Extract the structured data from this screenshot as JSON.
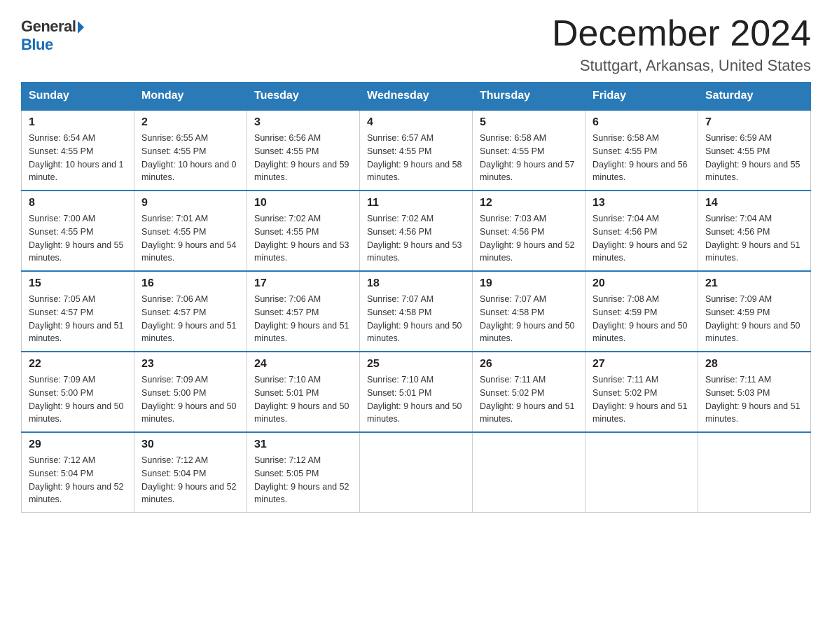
{
  "header": {
    "logo_general": "General",
    "logo_blue": "Blue",
    "month_year": "December 2024",
    "location": "Stuttgart, Arkansas, United States"
  },
  "days_of_week": [
    "Sunday",
    "Monday",
    "Tuesday",
    "Wednesday",
    "Thursday",
    "Friday",
    "Saturday"
  ],
  "weeks": [
    [
      {
        "day": "1",
        "sunrise": "6:54 AM",
        "sunset": "4:55 PM",
        "daylight": "10 hours and 1 minute."
      },
      {
        "day": "2",
        "sunrise": "6:55 AM",
        "sunset": "4:55 PM",
        "daylight": "10 hours and 0 minutes."
      },
      {
        "day": "3",
        "sunrise": "6:56 AM",
        "sunset": "4:55 PM",
        "daylight": "9 hours and 59 minutes."
      },
      {
        "day": "4",
        "sunrise": "6:57 AM",
        "sunset": "4:55 PM",
        "daylight": "9 hours and 58 minutes."
      },
      {
        "day": "5",
        "sunrise": "6:58 AM",
        "sunset": "4:55 PM",
        "daylight": "9 hours and 57 minutes."
      },
      {
        "day": "6",
        "sunrise": "6:58 AM",
        "sunset": "4:55 PM",
        "daylight": "9 hours and 56 minutes."
      },
      {
        "day": "7",
        "sunrise": "6:59 AM",
        "sunset": "4:55 PM",
        "daylight": "9 hours and 55 minutes."
      }
    ],
    [
      {
        "day": "8",
        "sunrise": "7:00 AM",
        "sunset": "4:55 PM",
        "daylight": "9 hours and 55 minutes."
      },
      {
        "day": "9",
        "sunrise": "7:01 AM",
        "sunset": "4:55 PM",
        "daylight": "9 hours and 54 minutes."
      },
      {
        "day": "10",
        "sunrise": "7:02 AM",
        "sunset": "4:55 PM",
        "daylight": "9 hours and 53 minutes."
      },
      {
        "day": "11",
        "sunrise": "7:02 AM",
        "sunset": "4:56 PM",
        "daylight": "9 hours and 53 minutes."
      },
      {
        "day": "12",
        "sunrise": "7:03 AM",
        "sunset": "4:56 PM",
        "daylight": "9 hours and 52 minutes."
      },
      {
        "day": "13",
        "sunrise": "7:04 AM",
        "sunset": "4:56 PM",
        "daylight": "9 hours and 52 minutes."
      },
      {
        "day": "14",
        "sunrise": "7:04 AM",
        "sunset": "4:56 PM",
        "daylight": "9 hours and 51 minutes."
      }
    ],
    [
      {
        "day": "15",
        "sunrise": "7:05 AM",
        "sunset": "4:57 PM",
        "daylight": "9 hours and 51 minutes."
      },
      {
        "day": "16",
        "sunrise": "7:06 AM",
        "sunset": "4:57 PM",
        "daylight": "9 hours and 51 minutes."
      },
      {
        "day": "17",
        "sunrise": "7:06 AM",
        "sunset": "4:57 PM",
        "daylight": "9 hours and 51 minutes."
      },
      {
        "day": "18",
        "sunrise": "7:07 AM",
        "sunset": "4:58 PM",
        "daylight": "9 hours and 50 minutes."
      },
      {
        "day": "19",
        "sunrise": "7:07 AM",
        "sunset": "4:58 PM",
        "daylight": "9 hours and 50 minutes."
      },
      {
        "day": "20",
        "sunrise": "7:08 AM",
        "sunset": "4:59 PM",
        "daylight": "9 hours and 50 minutes."
      },
      {
        "day": "21",
        "sunrise": "7:09 AM",
        "sunset": "4:59 PM",
        "daylight": "9 hours and 50 minutes."
      }
    ],
    [
      {
        "day": "22",
        "sunrise": "7:09 AM",
        "sunset": "5:00 PM",
        "daylight": "9 hours and 50 minutes."
      },
      {
        "day": "23",
        "sunrise": "7:09 AM",
        "sunset": "5:00 PM",
        "daylight": "9 hours and 50 minutes."
      },
      {
        "day": "24",
        "sunrise": "7:10 AM",
        "sunset": "5:01 PM",
        "daylight": "9 hours and 50 minutes."
      },
      {
        "day": "25",
        "sunrise": "7:10 AM",
        "sunset": "5:01 PM",
        "daylight": "9 hours and 50 minutes."
      },
      {
        "day": "26",
        "sunrise": "7:11 AM",
        "sunset": "5:02 PM",
        "daylight": "9 hours and 51 minutes."
      },
      {
        "day": "27",
        "sunrise": "7:11 AM",
        "sunset": "5:02 PM",
        "daylight": "9 hours and 51 minutes."
      },
      {
        "day": "28",
        "sunrise": "7:11 AM",
        "sunset": "5:03 PM",
        "daylight": "9 hours and 51 minutes."
      }
    ],
    [
      {
        "day": "29",
        "sunrise": "7:12 AM",
        "sunset": "5:04 PM",
        "daylight": "9 hours and 52 minutes."
      },
      {
        "day": "30",
        "sunrise": "7:12 AM",
        "sunset": "5:04 PM",
        "daylight": "9 hours and 52 minutes."
      },
      {
        "day": "31",
        "sunrise": "7:12 AM",
        "sunset": "5:05 PM",
        "daylight": "9 hours and 52 minutes."
      },
      null,
      null,
      null,
      null
    ]
  ]
}
